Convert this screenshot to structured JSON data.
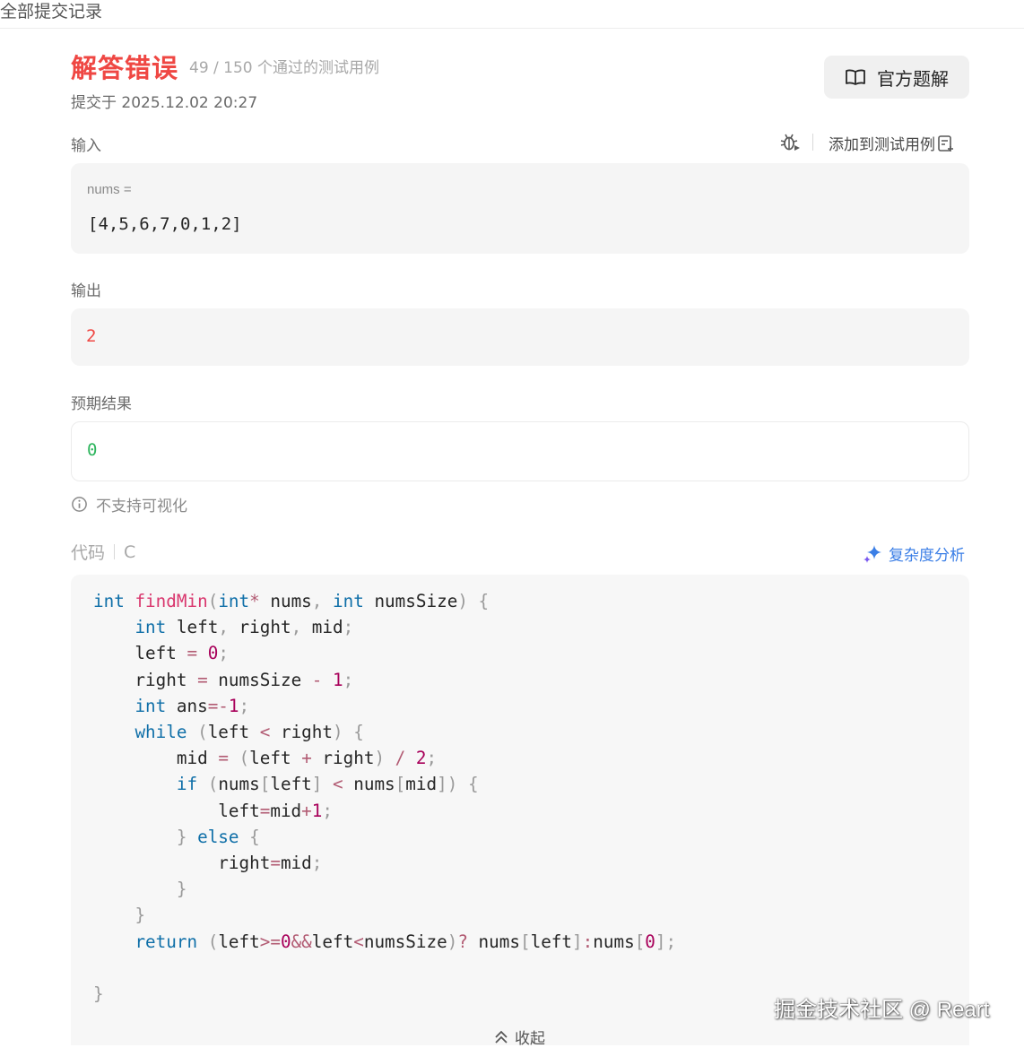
{
  "header": {
    "title": "全部提交记录"
  },
  "result": {
    "status": "解答错误",
    "passed": "49 / 150 个通过的测试用例",
    "submitted": "提交于 2025.12.02 20:27",
    "solution_button": "官方题解"
  },
  "input": {
    "label": "输入",
    "add_test_label": "添加到测试用例",
    "var_name": "nums =",
    "var_value": "[4,5,6,7,0,1,2]"
  },
  "output": {
    "label": "输出",
    "value": "2"
  },
  "expected": {
    "label": "预期结果",
    "value": "0"
  },
  "visualize_note": "不支持可视化",
  "code": {
    "label": "代码",
    "language": "C",
    "complexity_label": "复杂度分析",
    "collapse_label": "收起",
    "lines": [
      [
        [
          "kw",
          "int"
        ],
        [
          "t",
          " "
        ],
        [
          "fn",
          "findMin"
        ],
        [
          "p",
          "("
        ],
        [
          "kw",
          "int"
        ],
        [
          "op",
          "*"
        ],
        [
          "t",
          " nums"
        ],
        [
          "p",
          ","
        ],
        [
          "t",
          " "
        ],
        [
          "kw",
          "int"
        ],
        [
          "t",
          " numsSize"
        ],
        [
          "p",
          ")"
        ],
        [
          "t",
          " "
        ],
        [
          "p",
          "{"
        ]
      ],
      [
        [
          "t",
          "    "
        ],
        [
          "kw",
          "int"
        ],
        [
          "t",
          " left"
        ],
        [
          "p",
          ","
        ],
        [
          "t",
          " right"
        ],
        [
          "p",
          ","
        ],
        [
          "t",
          " mid"
        ],
        [
          "p",
          ";"
        ]
      ],
      [
        [
          "t",
          "    left "
        ],
        [
          "op",
          "="
        ],
        [
          "t",
          " "
        ],
        [
          "num",
          "0"
        ],
        [
          "p",
          ";"
        ]
      ],
      [
        [
          "t",
          "    right "
        ],
        [
          "op",
          "="
        ],
        [
          "t",
          " numsSize "
        ],
        [
          "op",
          "-"
        ],
        [
          "t",
          " "
        ],
        [
          "num",
          "1"
        ],
        [
          "p",
          ";"
        ]
      ],
      [
        [
          "t",
          "    "
        ],
        [
          "kw",
          "int"
        ],
        [
          "t",
          " ans"
        ],
        [
          "op",
          "=-"
        ],
        [
          "num",
          "1"
        ],
        [
          "p",
          ";"
        ]
      ],
      [
        [
          "t",
          "    "
        ],
        [
          "kw",
          "while"
        ],
        [
          "t",
          " "
        ],
        [
          "p",
          "("
        ],
        [
          "t",
          "left "
        ],
        [
          "op",
          "<"
        ],
        [
          "t",
          " right"
        ],
        [
          "p",
          ")"
        ],
        [
          "t",
          " "
        ],
        [
          "p",
          "{"
        ]
      ],
      [
        [
          "t",
          "        mid "
        ],
        [
          "op",
          "="
        ],
        [
          "t",
          " "
        ],
        [
          "p",
          "("
        ],
        [
          "t",
          "left "
        ],
        [
          "op",
          "+"
        ],
        [
          "t",
          " right"
        ],
        [
          "p",
          ")"
        ],
        [
          "t",
          " "
        ],
        [
          "op",
          "/"
        ],
        [
          "t",
          " "
        ],
        [
          "num",
          "2"
        ],
        [
          "p",
          ";"
        ]
      ],
      [
        [
          "t",
          "        "
        ],
        [
          "kw",
          "if"
        ],
        [
          "t",
          " "
        ],
        [
          "p",
          "("
        ],
        [
          "t",
          "nums"
        ],
        [
          "p",
          "["
        ],
        [
          "t",
          "left"
        ],
        [
          "p",
          "]"
        ],
        [
          "t",
          " "
        ],
        [
          "op",
          "<"
        ],
        [
          "t",
          " nums"
        ],
        [
          "p",
          "["
        ],
        [
          "t",
          "mid"
        ],
        [
          "p",
          "])"
        ],
        [
          "t",
          " "
        ],
        [
          "p",
          "{"
        ]
      ],
      [
        [
          "t",
          "            left"
        ],
        [
          "op",
          "="
        ],
        [
          "t",
          "mid"
        ],
        [
          "op",
          "+"
        ],
        [
          "num",
          "1"
        ],
        [
          "p",
          ";"
        ]
      ],
      [
        [
          "t",
          "        "
        ],
        [
          "p",
          "}"
        ],
        [
          "t",
          " "
        ],
        [
          "kw",
          "else"
        ],
        [
          "t",
          " "
        ],
        [
          "p",
          "{"
        ]
      ],
      [
        [
          "t",
          "            right"
        ],
        [
          "op",
          "="
        ],
        [
          "t",
          "mid"
        ],
        [
          "p",
          ";"
        ]
      ],
      [
        [
          "t",
          "        "
        ],
        [
          "p",
          "}"
        ]
      ],
      [
        [
          "t",
          "    "
        ],
        [
          "p",
          "}"
        ]
      ],
      [
        [
          "t",
          "    "
        ],
        [
          "kw",
          "return"
        ],
        [
          "t",
          " "
        ],
        [
          "p",
          "("
        ],
        [
          "t",
          "left"
        ],
        [
          "op",
          ">="
        ],
        [
          "num",
          "0"
        ],
        [
          "op",
          "&&"
        ],
        [
          "t",
          "left"
        ],
        [
          "op",
          "<"
        ],
        [
          "t",
          "numsSize"
        ],
        [
          "p",
          ")"
        ],
        [
          "op",
          "?"
        ],
        [
          "t",
          " nums"
        ],
        [
          "p",
          "["
        ],
        [
          "t",
          "left"
        ],
        [
          "p",
          "]"
        ],
        [
          "op",
          ":"
        ],
        [
          "t",
          "nums"
        ],
        [
          "p",
          "["
        ],
        [
          "num",
          "0"
        ],
        [
          "p",
          "];"
        ]
      ],
      [
        [
          "t",
          ""
        ]
      ],
      [
        [
          "p",
          "}"
        ]
      ]
    ]
  },
  "watermark": "掘金技术社区 @ Reart",
  "colors": {
    "error": "#ef4743",
    "expected": "#2db55d",
    "accent": "#3a7ee6"
  },
  "icons": {
    "solution": "book-icon",
    "debug": "bug-icon",
    "add_test": "add-testcase-icon",
    "info": "info-icon",
    "complexity": "sparkle-icon",
    "collapse": "chevron-up-icon"
  }
}
